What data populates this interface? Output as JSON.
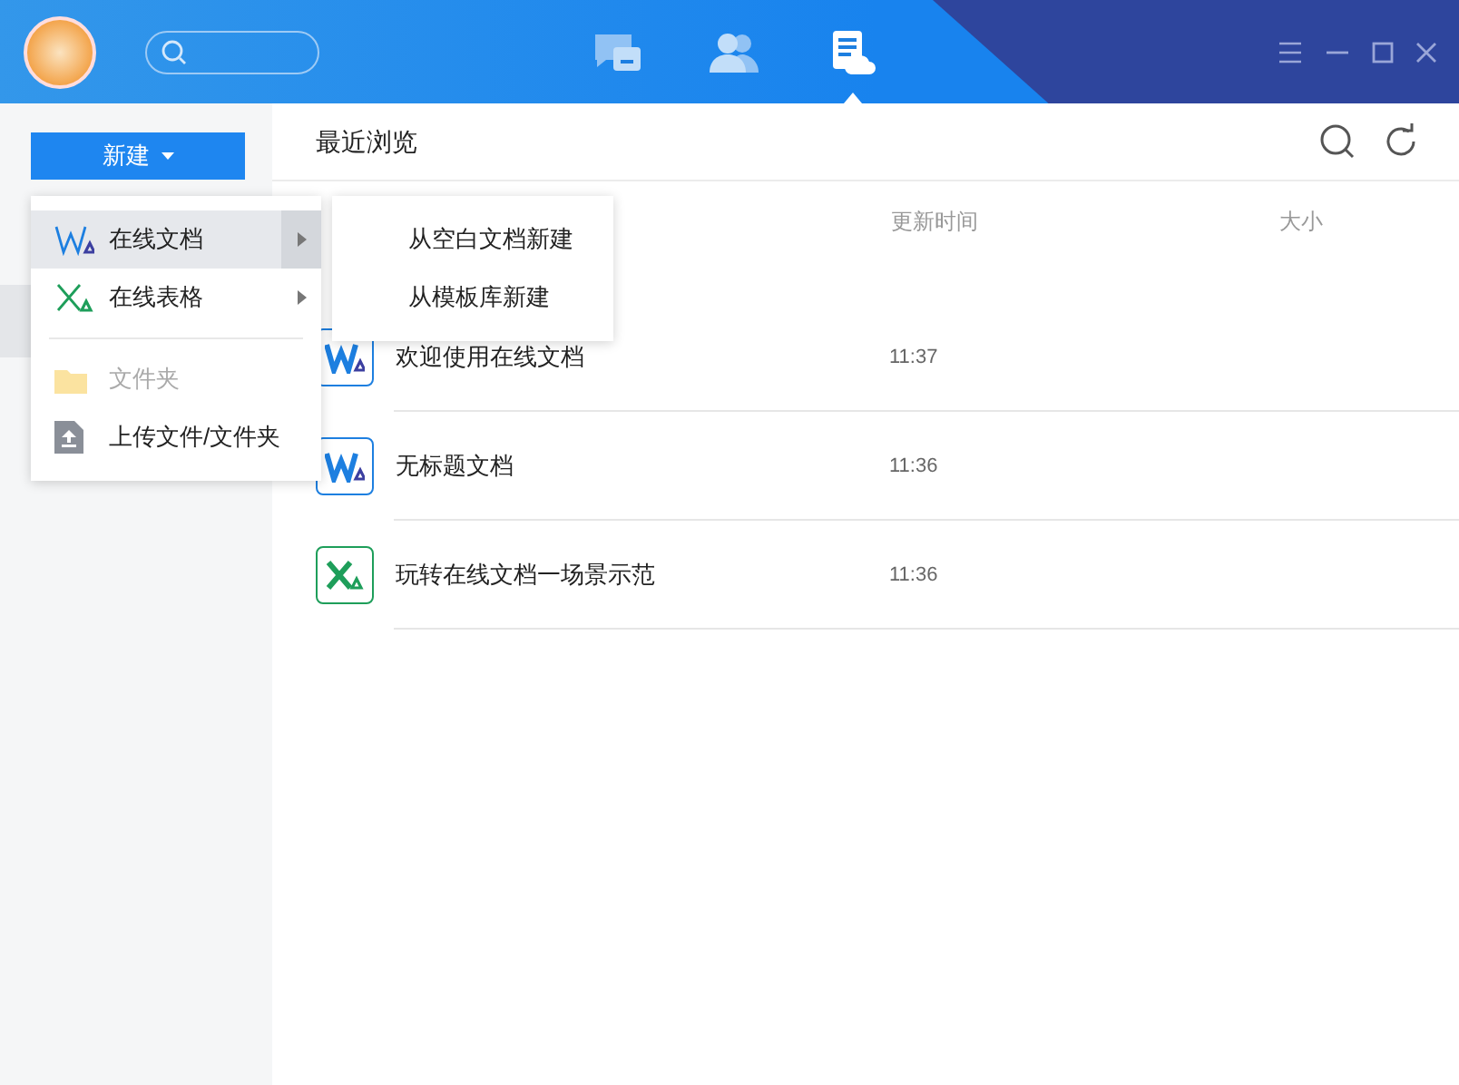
{
  "title_bar": {
    "tabs": [
      {
        "kind": "chat",
        "selected": false
      },
      {
        "kind": "contacts",
        "selected": false
      },
      {
        "kind": "docs",
        "selected": true
      }
    ]
  },
  "sidebar": {
    "new_button": "新建",
    "highlighted_row": true
  },
  "main": {
    "heading": "最近浏览",
    "columns": [
      {
        "label": "更新时间"
      },
      {
        "label": "大小"
      }
    ],
    "rows": [
      {
        "kind": "doc",
        "name": "欢迎使用在线文档",
        "time": "11:37"
      },
      {
        "kind": "doc",
        "name": "无标题文档",
        "time": "11:36"
      },
      {
        "kind": "sheet",
        "name": "玩转在线文档一场景示范",
        "time": "11:36"
      }
    ]
  },
  "new_menu": {
    "items": [
      {
        "kind": "doc",
        "label": "在线文档",
        "submenu": true,
        "selected": true,
        "disabled": false
      },
      {
        "kind": "sheet",
        "label": "在线表格",
        "submenu": true,
        "selected": false,
        "disabled": false
      },
      {
        "kind": "folder",
        "label": "文件夹",
        "submenu": false,
        "selected": false,
        "disabled": true
      },
      {
        "kind": "upload",
        "label": "上传文件/文件夹",
        "submenu": false,
        "selected": false,
        "disabled": false
      }
    ]
  },
  "submenu": {
    "items": [
      {
        "label": "从空白文档新建"
      },
      {
        "label": "从模板库新建"
      }
    ]
  }
}
